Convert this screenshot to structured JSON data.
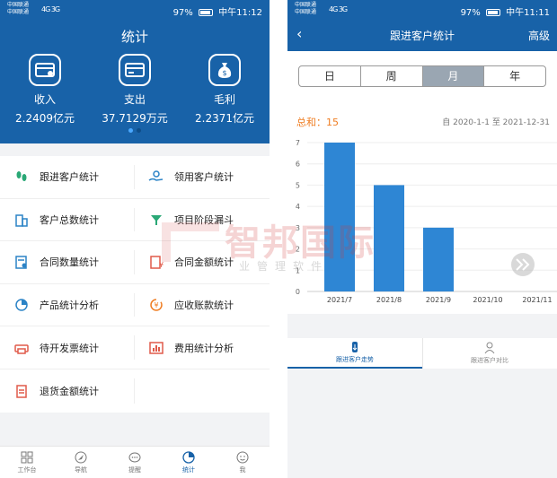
{
  "status": {
    "carrier1": "中国联通",
    "carrier2": "中国联通",
    "signal": "4G 3G",
    "battery": "97%",
    "time": "中午11:12",
    "time_right": "中午11:11"
  },
  "left": {
    "title": "统计",
    "summary": [
      {
        "label": "收入",
        "value": "2.2409亿元",
        "icon": "income-card-icon"
      },
      {
        "label": "支出",
        "value": "37.7129万元",
        "icon": "expense-card-icon"
      },
      {
        "label": "毛利",
        "value": "2.2371亿元",
        "icon": "money-bag-icon"
      }
    ],
    "menu": [
      {
        "label": "跟进客户统计",
        "icon": "footprints-icon",
        "color": "#2aa876"
      },
      {
        "label": "领用客户统计",
        "icon": "hand-receive-icon",
        "color": "#2b83c6"
      },
      {
        "label": "客户总数统计",
        "icon": "building-icon",
        "color": "#2b83c6"
      },
      {
        "label": "项目阶段漏斗",
        "icon": "funnel-icon",
        "color": "#2aa876"
      },
      {
        "label": "合同数量统计",
        "icon": "contract-icon",
        "color": "#2b83c6"
      },
      {
        "label": "合同金额统计",
        "icon": "contract-money-icon",
        "color": "#e05a4a"
      },
      {
        "label": "产品统计分析",
        "icon": "pie-icon",
        "color": "#2b83c6"
      },
      {
        "label": "应收账款统计",
        "icon": "receivable-icon",
        "color": "#ef7d22"
      },
      {
        "label": "待开发票统计",
        "icon": "printer-icon",
        "color": "#e05a4a"
      },
      {
        "label": "费用统计分析",
        "icon": "bar-chart-icon",
        "color": "#e05a4a"
      },
      {
        "label": "退货金额统计",
        "icon": "clipboard-icon",
        "color": "#e05a4a"
      }
    ],
    "tabs": [
      {
        "label": "工作台",
        "icon": "grid-icon"
      },
      {
        "label": "导航",
        "icon": "navigation-icon"
      },
      {
        "label": "提醒",
        "icon": "chat-icon"
      },
      {
        "label": "统计",
        "icon": "stats-icon"
      },
      {
        "label": "我",
        "icon": "face-icon"
      }
    ]
  },
  "watermark": {
    "big": "智邦国际",
    "small": "业管理软件"
  },
  "right": {
    "back": "‹",
    "title": "跟进客户统计",
    "advanced": "高级",
    "segments": [
      "日",
      "周",
      "月",
      "年"
    ],
    "selected_segment": "月",
    "total_label": "总和：",
    "total_value": "15",
    "range": "自 2020-1-1 至 2021-12-31",
    "bottom_tabs": [
      {
        "label": "跟进客户走势",
        "icon": "trend-icon"
      },
      {
        "label": "跟进客户对比",
        "icon": "compare-icon"
      }
    ]
  },
  "chart_data": {
    "type": "bar",
    "categories": [
      "2021/7",
      "2021/8",
      "2021/9",
      "2021/10",
      "2021/11"
    ],
    "values": [
      7,
      5,
      3,
      0,
      0
    ],
    "ylim": [
      0,
      7
    ],
    "yticks": [
      0,
      1,
      2,
      3,
      4,
      5,
      6,
      7
    ],
    "grid": true,
    "bar_color": "#2e86d4"
  }
}
